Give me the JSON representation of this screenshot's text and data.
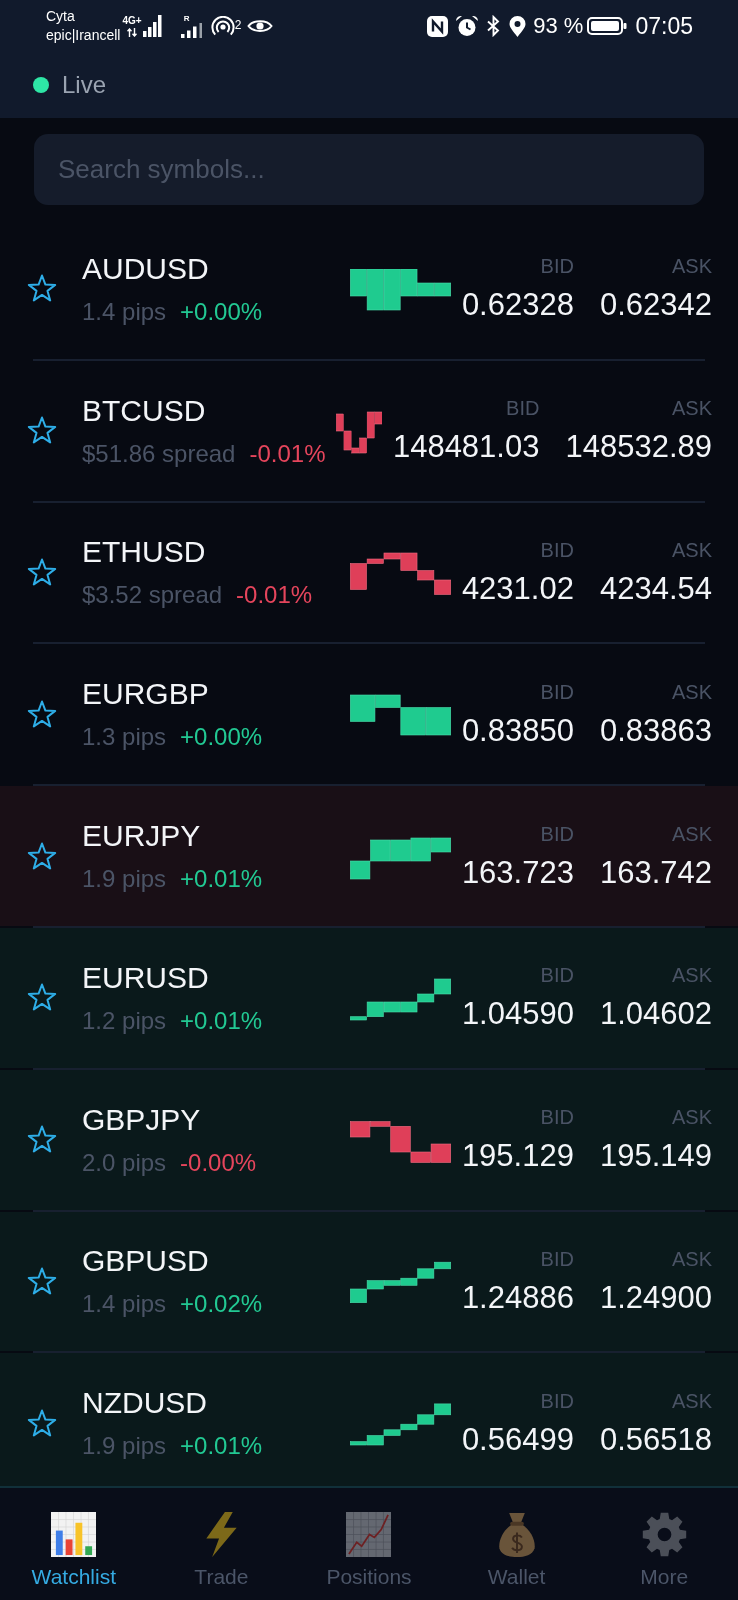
{
  "status_bar": {
    "carrier_lines": [
      "Cyta",
      "epic|Irancell"
    ],
    "network_label": "4G+",
    "roaming_label": "R",
    "hotspot_count": "2",
    "battery": "93 %",
    "time": "07:05"
  },
  "header": {
    "connection": {
      "label": "Live",
      "online": true
    }
  },
  "search": {
    "placeholder": "Search symbols..."
  },
  "watchlist": [
    {
      "symbol": "AUDUSD",
      "starred": false,
      "spread": "1.4 pips",
      "change": "+0.00%",
      "rising": true,
      "color": "#070a12",
      "bid_label": "BID",
      "bid": "0.62328",
      "ask_label": "ASK",
      "ask": "0.62342"
    },
    {
      "symbol": "BTCUSD",
      "starred": false,
      "spread": "$51.86 spread",
      "change": "-0.01%",
      "rising": false,
      "color": "#070a12",
      "bid_label": "BID",
      "bid": "148481.03",
      "ask_label": "ASK",
      "ask": "148532.89"
    },
    {
      "symbol": "ETHUSD",
      "starred": false,
      "spread": "$3.52 spread",
      "change": "-0.01%",
      "rising": false,
      "color": "#070a12",
      "bid_label": "BID",
      "bid": "4231.02",
      "ask_label": "ASK",
      "ask": "4234.54"
    },
    {
      "symbol": "EURGBP",
      "starred": false,
      "spread": "1.3 pips",
      "change": "+0.00%",
      "rising": true,
      "color": "#070a12",
      "bid_label": "BID",
      "bid": "0.83850",
      "ask_label": "ASK",
      "ask": "0.83863"
    },
    {
      "symbol": "EURJPY",
      "starred": false,
      "spread": "1.9 pips",
      "change": "+0.01%",
      "rising": true,
      "color": "#190f16",
      "bid_label": "BID",
      "bid": "163.723",
      "ask_label": "ASK",
      "ask": "163.742"
    },
    {
      "symbol": "EURUSD",
      "starred": false,
      "spread": "1.2 pips",
      "change": "+0.01%",
      "rising": true,
      "color": "#0a191b",
      "bid_label": "BID",
      "bid": "1.04590",
      "ask_label": "ASK",
      "ask": "1.04602"
    },
    {
      "symbol": "GBPJPY",
      "starred": false,
      "spread": "2.0 pips",
      "change": "-0.00%",
      "rising": false,
      "color": "#0a191b",
      "bid_label": "BID",
      "bid": "195.129",
      "ask_label": "ASK",
      "ask": "195.149"
    },
    {
      "symbol": "GBPUSD",
      "starred": false,
      "spread": "1.4 pips",
      "change": "+0.02%",
      "rising": true,
      "color": "#0a191b",
      "bid_label": "BID",
      "bid": "1.24886",
      "ask_label": "ASK",
      "ask": "1.24900"
    },
    {
      "symbol": "NZDUSD",
      "starred": false,
      "spread": "1.9 pips",
      "change": "+0.01%",
      "rising": true,
      "color": "#0a191b",
      "bid_label": "BID",
      "bid": "0.56499",
      "ask_label": "ASK",
      "ask": "0.56518"
    }
  ],
  "nav": [
    {
      "label": "Watchlist",
      "selected": true
    },
    {
      "label": "Trade",
      "selected": false
    },
    {
      "label": "Positions",
      "selected": false
    },
    {
      "label": "Wallet",
      "selected": false
    },
    {
      "label": "More",
      "selected": false
    }
  ]
}
